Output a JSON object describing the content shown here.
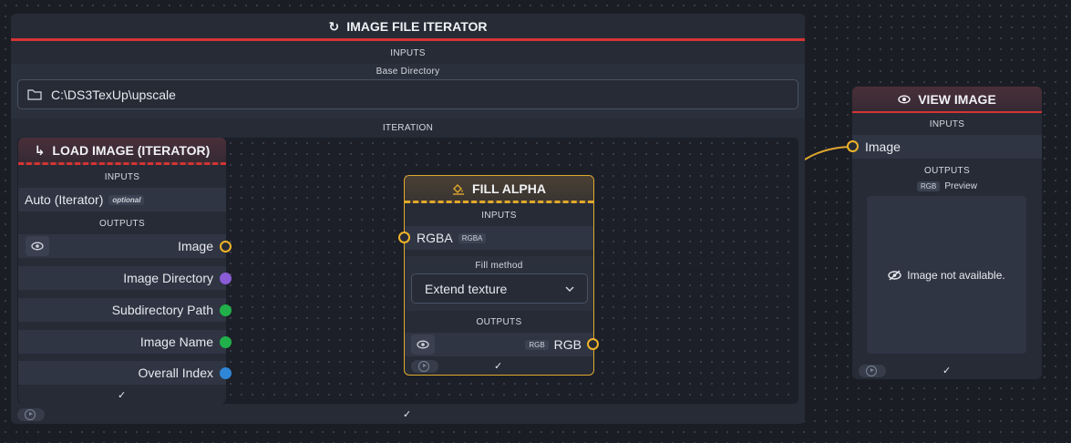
{
  "iterator": {
    "title": "IMAGE FILE ITERATOR",
    "inputs_label": "INPUTS",
    "base_dir_label": "Base Directory",
    "base_dir_value": "C:\\DS3TexUp\\upscale",
    "iteration_label": "ITERATION",
    "check": "✓"
  },
  "load_image": {
    "title": "LOAD IMAGE (ITERATOR)",
    "inputs_label": "INPUTS",
    "auto_label": "Auto (Iterator)",
    "optional_tag": "optional",
    "outputs_label": "OUTPUTS",
    "outputs": [
      {
        "label": "Image",
        "color": "#f0b429"
      },
      {
        "label": "Image Directory",
        "color": "#8a5cd6"
      },
      {
        "label": "Subdirectory Path",
        "color": "#21b04a"
      },
      {
        "label": "Image Name",
        "color": "#21b04a"
      },
      {
        "label": "Overall Index",
        "color": "#2f86d6"
      }
    ],
    "check": "✓"
  },
  "fill_alpha": {
    "title": "FILL ALPHA",
    "inputs_label": "INPUTS",
    "input_label": "RGBA",
    "input_tag": "RGBA",
    "method_label": "Fill method",
    "method_value": "Extend texture",
    "outputs_label": "OUTPUTS",
    "output_tag": "RGB",
    "output_label": "RGB",
    "check": "✓"
  },
  "view_image": {
    "title": "VIEW IMAGE",
    "inputs_label": "INPUTS",
    "input_label": "Image",
    "outputs_label": "OUTPUTS",
    "preview_tag": "RGB",
    "preview_label": "Preview",
    "not_available": "Image not available.",
    "check": "✓"
  },
  "colors": {
    "iterator_accent": "#d43434",
    "fill_accent": "#e0a92c",
    "image_handle": "#f0b429",
    "edge": "#e2a72e"
  }
}
